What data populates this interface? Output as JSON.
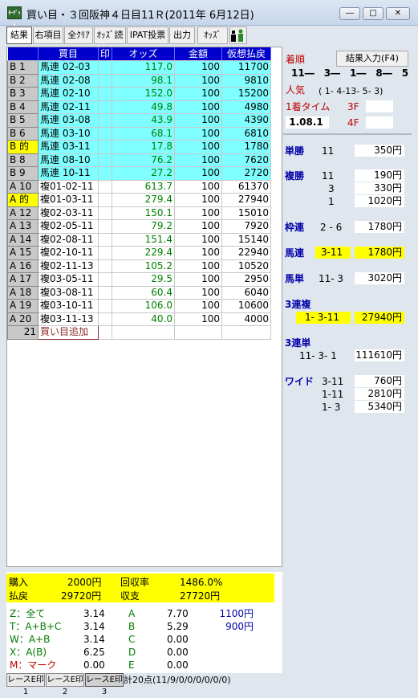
{
  "window": {
    "title": "買い目・３回阪神４日目11Ｒ(2011年 6月12日)",
    "app_icon": "ﾀｰｹﾞｯﾄ",
    "min_label": "―",
    "max_label": "□",
    "close_label": "✕"
  },
  "toolbar": {
    "result": "結果",
    "right_item": "右項目",
    "all_clear": "全ｸﾘｱ",
    "odds_read": "ｵｯｽﾞ読",
    "ipat": "IPAT投票",
    "output": "出力",
    "odds": "ｵｯｽﾞ",
    "person_icon": "person-icon"
  },
  "table": {
    "headers": [
      "",
      "買目",
      "印",
      "オッズ",
      "金額",
      "仮想払戻"
    ],
    "rows": [
      {
        "id": "B  1",
        "bet": "馬連 02-03",
        "mark": "",
        "odds": "117.0",
        "amount": "100",
        "payout": "11700",
        "cyan": true,
        "hl": false
      },
      {
        "id": "B  2",
        "bet": "馬連 02-08",
        "mark": "",
        "odds": "98.1",
        "amount": "100",
        "payout": "9810",
        "cyan": true,
        "hl": false
      },
      {
        "id": "B  3",
        "bet": "馬連 02-10",
        "mark": "",
        "odds": "152.0",
        "amount": "100",
        "payout": "15200",
        "cyan": true,
        "hl": false
      },
      {
        "id": "B  4",
        "bet": "馬連 02-11",
        "mark": "",
        "odds": "49.8",
        "amount": "100",
        "payout": "4980",
        "cyan": true,
        "hl": false
      },
      {
        "id": "B  5",
        "bet": "馬連 03-08",
        "mark": "",
        "odds": "43.9",
        "amount": "100",
        "payout": "4390",
        "cyan": true,
        "hl": false
      },
      {
        "id": "B  6",
        "bet": "馬連 03-10",
        "mark": "",
        "odds": "68.1",
        "amount": "100",
        "payout": "6810",
        "cyan": true,
        "hl": false
      },
      {
        "id": "B 的",
        "bet": "馬連 03-11",
        "mark": "",
        "odds": "17.8",
        "amount": "100",
        "payout": "1780",
        "cyan": true,
        "hl": true
      },
      {
        "id": "B  8",
        "bet": "馬連 08-10",
        "mark": "",
        "odds": "76.2",
        "amount": "100",
        "payout": "7620",
        "cyan": true,
        "hl": false
      },
      {
        "id": "B  9",
        "bet": "馬連 10-11",
        "mark": "",
        "odds": "27.2",
        "amount": "100",
        "payout": "2720",
        "cyan": true,
        "hl": false
      },
      {
        "id": "A 10",
        "bet": "複01-02-11",
        "mark": "",
        "odds": "613.7",
        "amount": "100",
        "payout": "61370",
        "cyan": false,
        "hl": false
      },
      {
        "id": "A 的",
        "bet": "複01-03-11",
        "mark": "",
        "odds": "279.4",
        "amount": "100",
        "payout": "27940",
        "cyan": false,
        "hl": true
      },
      {
        "id": "A 12",
        "bet": "複02-03-11",
        "mark": "",
        "odds": "150.1",
        "amount": "100",
        "payout": "15010",
        "cyan": false,
        "hl": false
      },
      {
        "id": "A 13",
        "bet": "複02-05-11",
        "mark": "",
        "odds": "79.2",
        "amount": "100",
        "payout": "7920",
        "cyan": false,
        "hl": false
      },
      {
        "id": "A 14",
        "bet": "複02-08-11",
        "mark": "",
        "odds": "151.4",
        "amount": "100",
        "payout": "15140",
        "cyan": false,
        "hl": false
      },
      {
        "id": "A 15",
        "bet": "複02-10-11",
        "mark": "",
        "odds": "229.4",
        "amount": "100",
        "payout": "22940",
        "cyan": false,
        "hl": false
      },
      {
        "id": "A 16",
        "bet": "複02-11-13",
        "mark": "",
        "odds": "105.2",
        "amount": "100",
        "payout": "10520",
        "cyan": false,
        "hl": false
      },
      {
        "id": "A 17",
        "bet": "複03-05-11",
        "mark": "",
        "odds": "29.5",
        "amount": "100",
        "payout": "2950",
        "cyan": false,
        "hl": false
      },
      {
        "id": "A 18",
        "bet": "複03-08-11",
        "mark": "",
        "odds": "60.4",
        "amount": "100",
        "payout": "6040",
        "cyan": false,
        "hl": false
      },
      {
        "id": "A 19",
        "bet": "複03-10-11",
        "mark": "",
        "odds": "106.0",
        "amount": "100",
        "payout": "10600",
        "cyan": false,
        "hl": false
      },
      {
        "id": "A 20",
        "bet": "複03-11-13",
        "mark": "",
        "odds": "40.0",
        "amount": "100",
        "payout": "4000",
        "cyan": false,
        "hl": false
      }
    ],
    "add_row": {
      "id": "21",
      "label": "買い目追加"
    }
  },
  "result": {
    "order_label": "着順",
    "input_button": "結果入力(F4)",
    "order": "11―　3―　1―　8―　5",
    "popularity_label": "人気",
    "popularity": "( 1- 4-13- 5- 3)",
    "first_time_label": "1着タイム",
    "time": "1.08.1",
    "f3_label": "3F",
    "f4_label": "4F",
    "tansho_label": "単勝",
    "tansho": {
      "horse": "11",
      "pay": "350円"
    },
    "fukusho_label": "複勝",
    "fukusho": [
      {
        "horse": "11",
        "pay": "190円"
      },
      {
        "horse": "3",
        "pay": "330円"
      },
      {
        "horse": "1",
        "pay": "1020円"
      }
    ],
    "wakuren_label": "枠連",
    "wakuren": {
      "combo": "2 - 6",
      "pay": "1780円"
    },
    "umaren_label": "馬連",
    "umaren": {
      "combo": "3-11",
      "pay": "1780円"
    },
    "umatan_label": "馬単",
    "umatan": {
      "combo": "11- 3",
      "pay": "3020円"
    },
    "sanrenpuku_label": "3連複",
    "sanrenpuku": {
      "combo": "1- 3-11",
      "pay": "27940円"
    },
    "sanrentan_label": "3連単",
    "sanrentan": {
      "combo": "11- 3- 1",
      "pay": "111610円"
    },
    "wide_label": "ワイド",
    "wide": [
      {
        "combo": "3-11",
        "pay": "760円"
      },
      {
        "combo": "1-11",
        "pay": "2810円"
      },
      {
        "combo": "1- 3",
        "pay": "5340円"
      }
    ]
  },
  "summary": {
    "purchase_label": "購入",
    "purchase": "2000円",
    "return_rate_label": "回収率",
    "return_rate": "1486.0%",
    "refund_label": "払戻",
    "refund": "29720円",
    "balance_label": "収支",
    "balance": "27720円",
    "rows_left": [
      {
        "label": "Z：全て",
        "value": "3.14"
      },
      {
        "label": "T：A+B+C",
        "value": "3.14"
      },
      {
        "label": "W：A+B",
        "value": "3.14"
      },
      {
        "label": "X：A(B)",
        "value": "6.25"
      },
      {
        "label": "M：マーク",
        "value": "0.00"
      }
    ],
    "rows_right": [
      {
        "label": "A",
        "value": "7.70",
        "pay": "1100円"
      },
      {
        "label": "B",
        "value": "5.29",
        "pay": "900円"
      },
      {
        "label": "C",
        "value": "0.00",
        "pay": ""
      },
      {
        "label": "D",
        "value": "0.00",
        "pay": ""
      },
      {
        "label": "E",
        "value": "0.00",
        "pay": ""
      }
    ]
  },
  "tabs": [
    "レースE印1",
    "レースE印2",
    "レースE印3"
  ],
  "status": "計20点(11/9/0/0/0/0/0/0)"
}
